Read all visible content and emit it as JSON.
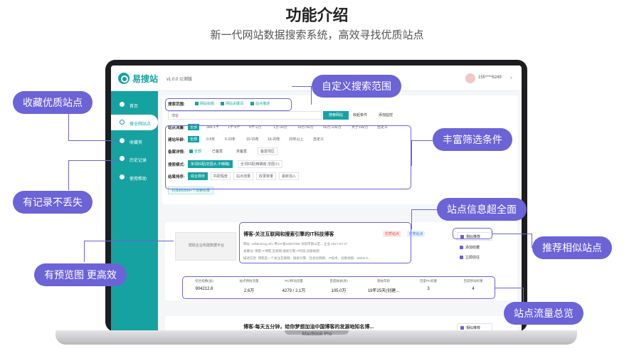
{
  "hero": {
    "title": "功能介绍",
    "subtitle": "新一代网站数据搜索系统，高效寻找优质站点"
  },
  "laptop": {
    "label": "MacBook Pro"
  },
  "app": {
    "name": "易搜站",
    "version": "v1.0.0 公测版",
    "user": "155****6249"
  },
  "sidebar": {
    "items": [
      {
        "label": "首页",
        "icon": "home-icon"
      },
      {
        "label": "搜全网站点",
        "icon": "search-icon"
      },
      {
        "label": "收藏夹",
        "icon": "star-icon"
      },
      {
        "label": "历史记录",
        "icon": "history-icon"
      },
      {
        "label": "使用帮助",
        "icon": "help-icon"
      }
    ]
  },
  "search": {
    "scope_label": "搜索范围:",
    "scope_opts": [
      "网站标题",
      "网站关键词",
      "站点描述"
    ],
    "input_value": "博客",
    "button": "搜索网站",
    "collect_cond": "收起条件",
    "add_monitor": "添加监控",
    "traffic_label": "站点流量:",
    "traffic_opts": [
      "全部",
      "300-1千",
      "1千-5千",
      "5千-1万",
      "1万-10万",
      "10万-50万",
      "50万-100万",
      "大于100万",
      "自定义"
    ],
    "age_label": "建站年龄:",
    "age_opts": [
      "全部",
      "0-5年",
      "5-10年",
      "10-15年",
      "15-20年",
      "20年以上",
      "自定义"
    ],
    "icp_label": "备案详情:",
    "icp_opts": [
      "全部",
      "已备案",
      "未备案"
    ],
    "icp_region": "备案地区",
    "mode_label": "搜索模式:",
    "mode_opts": [
      "单词匹配(范围大,不精确)",
      "全词匹配(精确度,范围小)"
    ],
    "sort_label": "结果排序:",
    "sort_opts": [
      "综合排序",
      "匹配程度",
      "站点流量",
      "收录数量",
      "最新加入"
    ],
    "result_count": "共找到9999+个搜索结果"
  },
  "result": {
    "thumb_title": "帮助企业构建数据平台",
    "title": "博客-关注互联网和搜索引擎的IT科技博客",
    "badge_hot": "优质站点",
    "badge_it": "IT类站点",
    "meta1": "网址: williamlong.info    粤ICP备16007008    深圳市南山区...    企业    2017-07-27",
    "meta2": "关键词: 博客,IT博客,互联网,搜索引擎,IT科技,谷歌地图",
    "meta3": "描述信息: 博客是一个关注互联网、搜索引擎、社会化网络、IT技术、谷歌地图、Web2.0...",
    "btn_similar": "相似推荐",
    "btn_fav": "添加收藏",
    "btn_visit": "立即前往",
    "stats": [
      {
        "label": "综合指数(总)",
        "value": "904212.6"
      },
      {
        "label": "站点预估流量",
        "value": "2.6万"
      },
      {
        "label": "PC/移动流量",
        "value": "4279 / 2.1万"
      },
      {
        "label": "百度收录(条)",
        "value": "105.0万"
      },
      {
        "label": "建站年龄",
        "value": "19年25天(创建..."
      },
      {
        "label": "百度PC权重",
        "value": "3"
      },
      {
        "label": "百度移动权重",
        "value": "4"
      }
    ]
  },
  "result2": {
    "title": "博客-每天五分钟，给你梦想加油中国博客的发源地知名博...",
    "btn_similar": "相似推荐"
  },
  "annotations": {
    "fav": "收藏优质站点",
    "custom": "自定义搜索范围",
    "filters": "丰富筛选条件",
    "history": "有记录不丢失",
    "info": "站点信息超全面",
    "similar": "推荐相似站点",
    "preview": "有预览图 更高效",
    "traffic": "站点流量总览"
  },
  "colors": {
    "accent": "#17a2a2",
    "annotation": "#6c63d7"
  }
}
